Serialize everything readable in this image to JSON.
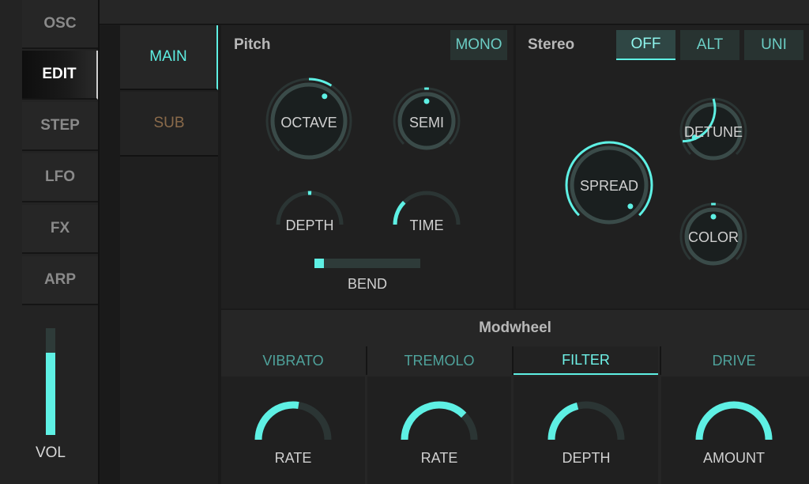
{
  "sidebar": {
    "items": [
      {
        "label": "OSC",
        "active": false
      },
      {
        "label": "EDIT",
        "active": true
      },
      {
        "label": "STEP",
        "active": false
      },
      {
        "label": "LFO",
        "active": false
      },
      {
        "label": "FX",
        "active": false
      },
      {
        "label": "ARP",
        "active": false
      }
    ],
    "volume": {
      "label": "VOL",
      "level": 0.77
    }
  },
  "subtabs": {
    "main": "MAIN",
    "sub": "SUB"
  },
  "pitch": {
    "title": "Pitch",
    "mono_button": "MONO",
    "knobs": {
      "octave": {
        "label": "OCTAVE",
        "value": 0.62
      },
      "semi": {
        "label": "SEMI",
        "value": 0.5
      },
      "depth": {
        "label": "DEPTH",
        "value": 0.5
      },
      "time": {
        "label": "TIME",
        "value": 0.25
      }
    },
    "bend": {
      "label": "BEND",
      "value": 0.0
    }
  },
  "stereo": {
    "title": "Stereo",
    "buttons": {
      "off": "OFF",
      "alt": "ALT",
      "uni": "UNI"
    },
    "selected": "OFF",
    "knobs": {
      "spread": {
        "label": "SPREAD",
        "value": 1.0
      },
      "detune": {
        "label": "DETUNE",
        "value": 0.1
      },
      "color": {
        "label": "COLOR",
        "value": 0.5
      }
    }
  },
  "modwheel": {
    "title": "Modwheel",
    "tabs": [
      {
        "label": "VIBRATO",
        "active": false
      },
      {
        "label": "TREMOLO",
        "active": false
      },
      {
        "label": "FILTER",
        "active": true
      },
      {
        "label": "DRIVE",
        "active": false
      }
    ],
    "cells": [
      {
        "label": "RATE",
        "value": 0.55
      },
      {
        "label": "RATE",
        "value": 0.75
      },
      {
        "label": "DEPTH",
        "value": 0.42
      },
      {
        "label": "AMOUNT",
        "value": 1.0
      }
    ]
  },
  "colors": {
    "accent": "#5ef0e4",
    "track": "#2e3b39",
    "knob_face": "#1a1f1f"
  }
}
